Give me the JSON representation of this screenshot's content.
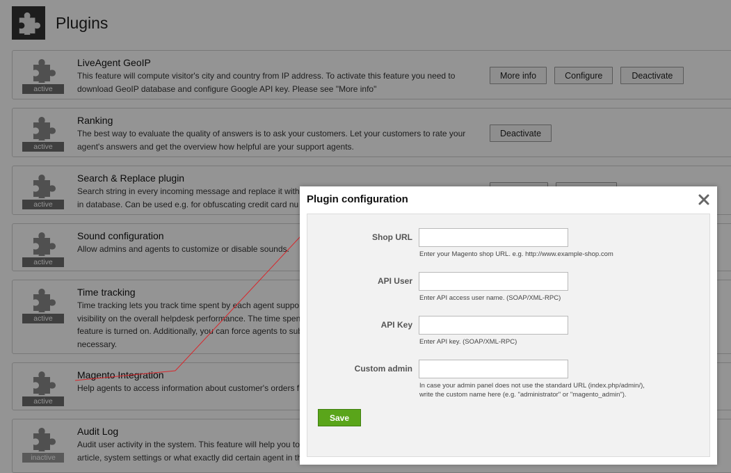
{
  "header": {
    "title": "Plugins",
    "icon": "puzzle-icon"
  },
  "plugins": [
    {
      "name": "LiveAgent GeoIP",
      "desc": "This feature will compute visitor's city and country from IP address. To activate this feature you need to download GeoIP database and configure Google API key. Please see \"More info\"",
      "status": "active",
      "buttons": [
        "More info",
        "Configure",
        "Deactivate"
      ]
    },
    {
      "name": "Ranking",
      "desc": "The best way to evaluate the quality of answers is to ask your customers. Let your customers to rate your agent's answers and get the overview how helpful are your support agents.",
      "status": "active",
      "buttons": [
        "Deactivate"
      ]
    },
    {
      "name": "Search & Replace plugin",
      "desc": "Search string in every incoming message and replace it with",
      "desc2": "in database. Can be used e.g. for obfuscating credit card nu",
      "status": "active"
    },
    {
      "name": "Sound configuration",
      "desc": "Allow admins and agents to customize or disable sounds.",
      "status": "active"
    },
    {
      "name": "Time tracking",
      "desc": "Time tracking lets you track time spent by each agent suppo",
      "desc2": "visibility on the overall helpdesk performance. The time spen",
      "desc3": "feature is turned on. Additionally, you can force agents to sub",
      "desc4": "necessary.",
      "status": "active"
    },
    {
      "name": "Magento Integration",
      "desc": "Help agents to access information about customer's orders f",
      "status": "active"
    },
    {
      "name": "Audit Log",
      "desc": "Audit user activity in the system. This feature will help you to",
      "desc2": "article, system settings or what exactly did certain agent in th",
      "status": "inactive"
    }
  ],
  "modal": {
    "title": "Plugin configuration",
    "close_icon": "close-icon",
    "fields": [
      {
        "label": "Shop URL",
        "value": "",
        "help": "Enter your Magento shop URL. e.g. http://www.example-shop.com"
      },
      {
        "label": "API User",
        "value": "",
        "help": "Enter API access user name. (SOAP/XML-RPC)"
      },
      {
        "label": "API Key",
        "value": "",
        "help": "Enter API key. (SOAP/XML-RPC)"
      },
      {
        "label": "Custom admin",
        "value": "",
        "help": "In case your admin panel does not use the standard URL (index.php/admin/),",
        "help2": "write the custom name here (e.g. \"administrator\" or \"magento_admin\")."
      }
    ],
    "save_label": "Save"
  },
  "colors": {
    "save": "#5aa51a",
    "badge": "#6d6d6d",
    "annotation": "#d9252a"
  }
}
